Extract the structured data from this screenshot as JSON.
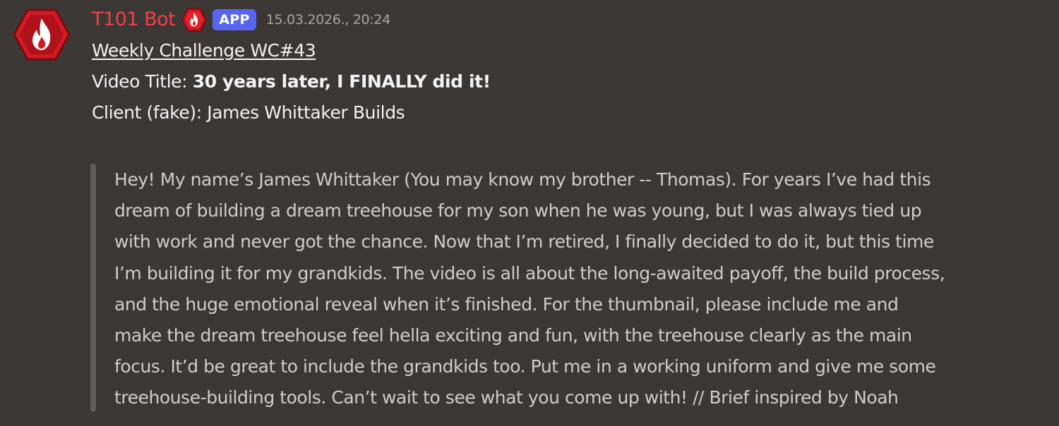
{
  "message": {
    "author": "T101 Bot",
    "badge": "APP",
    "timestamp": "15.03.2026., 20:24",
    "avatar_icon": "flame-icon",
    "role_icon": "flame-icon",
    "colors": {
      "background": "#3b3735",
      "username": "#f23f43",
      "badge": "#5865f2",
      "avatar_red": "#c3141e",
      "quote_bar": "#5f5d5e"
    },
    "challenge_link": "Weekly Challenge WC#43",
    "video_title_label": "Video Title: ",
    "video_title_value": "30 years later, I FINALLY did it!",
    "client_line": "Client (fake): James Whittaker Builds",
    "quote_lines": [
      "Hey! My name’s James Whittaker (You may know my brother -- Thomas). For years I’ve had this",
      "dream of building a dream treehouse for my son when he was young, but I was always tied up",
      "with work and never got the chance. Now that I’m retired, I finally decided to do it, but this time",
      "I’m building it for my grandkids. The video is all about the long-awaited payoff, the build process,",
      "and the huge emotional reveal when it’s finished. For the thumbnail, please include me and",
      "make the dream treehouse feel hella exciting and fun, with the treehouse clearly as the main",
      "focus. It’d be great to include the grandkids too. Put me in a working uniform and give me some",
      "treehouse-building tools. Can’t wait to see what you come up with! // Brief inspired by Noah"
    ]
  }
}
